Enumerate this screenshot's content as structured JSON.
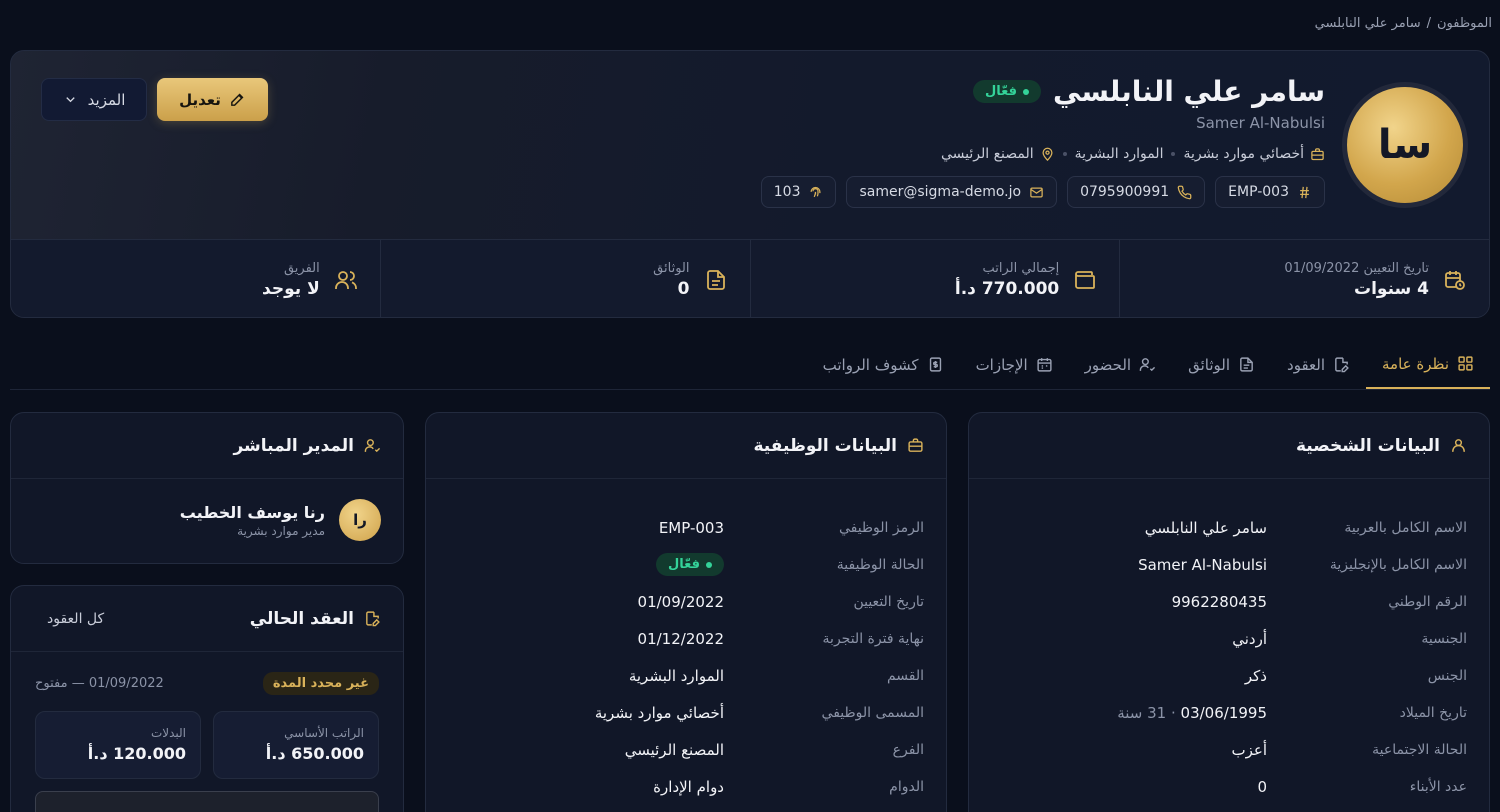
{
  "breadcrumb": {
    "root": "الموظفون",
    "separator": "/",
    "current": "سامر علي النابلسي"
  },
  "profile": {
    "avatar_initials": "سا",
    "name_ar": "سامر علي النابلسي",
    "name_en": "Samer Al-Nabulsi",
    "status": "فعّال",
    "job_title": "أخصائي موارد بشرية",
    "department": "الموارد البشرية",
    "branch": "المصنع الرئيسي",
    "chips": {
      "code": "EMP-003",
      "phone": "0795900991",
      "email": "samer@sigma-demo.jo",
      "fingerprint": "103"
    },
    "edit_label": "تعديل",
    "more_label": "المزيد"
  },
  "stats": [
    {
      "label": "تاريخ التعيين 01/09/2022",
      "value": "4 سنوات",
      "icon": "calendar-clock-icon"
    },
    {
      "label": "إجمالي الراتب",
      "value": "770.000 د.أ",
      "icon": "wallet-icon"
    },
    {
      "label": "الوثائق",
      "value": "0",
      "icon": "document-icon"
    },
    {
      "label": "الفريق",
      "value": "لا يوجد",
      "icon": "users-icon"
    }
  ],
  "tabs": [
    {
      "label": "نظرة عامة",
      "icon": "grid-icon",
      "active": true
    },
    {
      "label": "العقود",
      "icon": "contract-icon",
      "active": false
    },
    {
      "label": "الوثائق",
      "icon": "file-icon",
      "active": false
    },
    {
      "label": "الحضور",
      "icon": "user-check-icon",
      "active": false
    },
    {
      "label": "الإجازات",
      "icon": "calendar-icon",
      "active": false
    },
    {
      "label": "كشوف الرواتب",
      "icon": "receipt-icon",
      "active": false
    }
  ],
  "personal": {
    "title": "البيانات الشخصية",
    "rows": [
      {
        "k": "الاسم الكامل بالعربية",
        "v": "سامر علي النابلسي"
      },
      {
        "k": "الاسم الكامل بالإنجليزية",
        "v": "Samer Al-Nabulsi"
      },
      {
        "k": "الرقم الوطني",
        "v": "9962280435"
      },
      {
        "k": "الجنسية",
        "v": "أردني"
      },
      {
        "k": "الجنس",
        "v": "ذكر"
      },
      {
        "k": "تاريخ الميلاد",
        "v": "03/06/1995",
        "extra": " · 31 سنة"
      },
      {
        "k": "الحالة الاجتماعية",
        "v": "أعزب"
      },
      {
        "k": "عدد الأبناء",
        "v": "0"
      }
    ]
  },
  "job": {
    "title": "البيانات الوظيفية",
    "rows": [
      {
        "k": "الرمز الوظيفي",
        "v": "EMP-003"
      },
      {
        "k": "الحالة الوظيفية",
        "v": "فعّال",
        "badge": true
      },
      {
        "k": "تاريخ التعيين",
        "v": "01/09/2022"
      },
      {
        "k": "نهاية فترة التجربة",
        "v": "01/12/2022"
      },
      {
        "k": "القسم",
        "v": "الموارد البشرية"
      },
      {
        "k": "المسمى الوظيفي",
        "v": "أخصائي موارد بشرية"
      },
      {
        "k": "الفرع",
        "v": "المصنع الرئيسي"
      },
      {
        "k": "الدوام",
        "v": "دوام الإدارة"
      }
    ]
  },
  "manager": {
    "title": "المدير المباشر",
    "initials": "را",
    "name": "رنا يوسف الخطيب",
    "role": "مدير موارد بشرية"
  },
  "contract": {
    "title": "العقد الحالي",
    "all_link": "كل العقود",
    "type_badge": "غير محدد المدة",
    "period": "01/09/2022 — مفتوح",
    "basic_label": "الراتب الأساسي",
    "basic_value": "650.000 د.أ",
    "allow_label": "البدلات",
    "allow_value": "120.000 د.أ"
  }
}
